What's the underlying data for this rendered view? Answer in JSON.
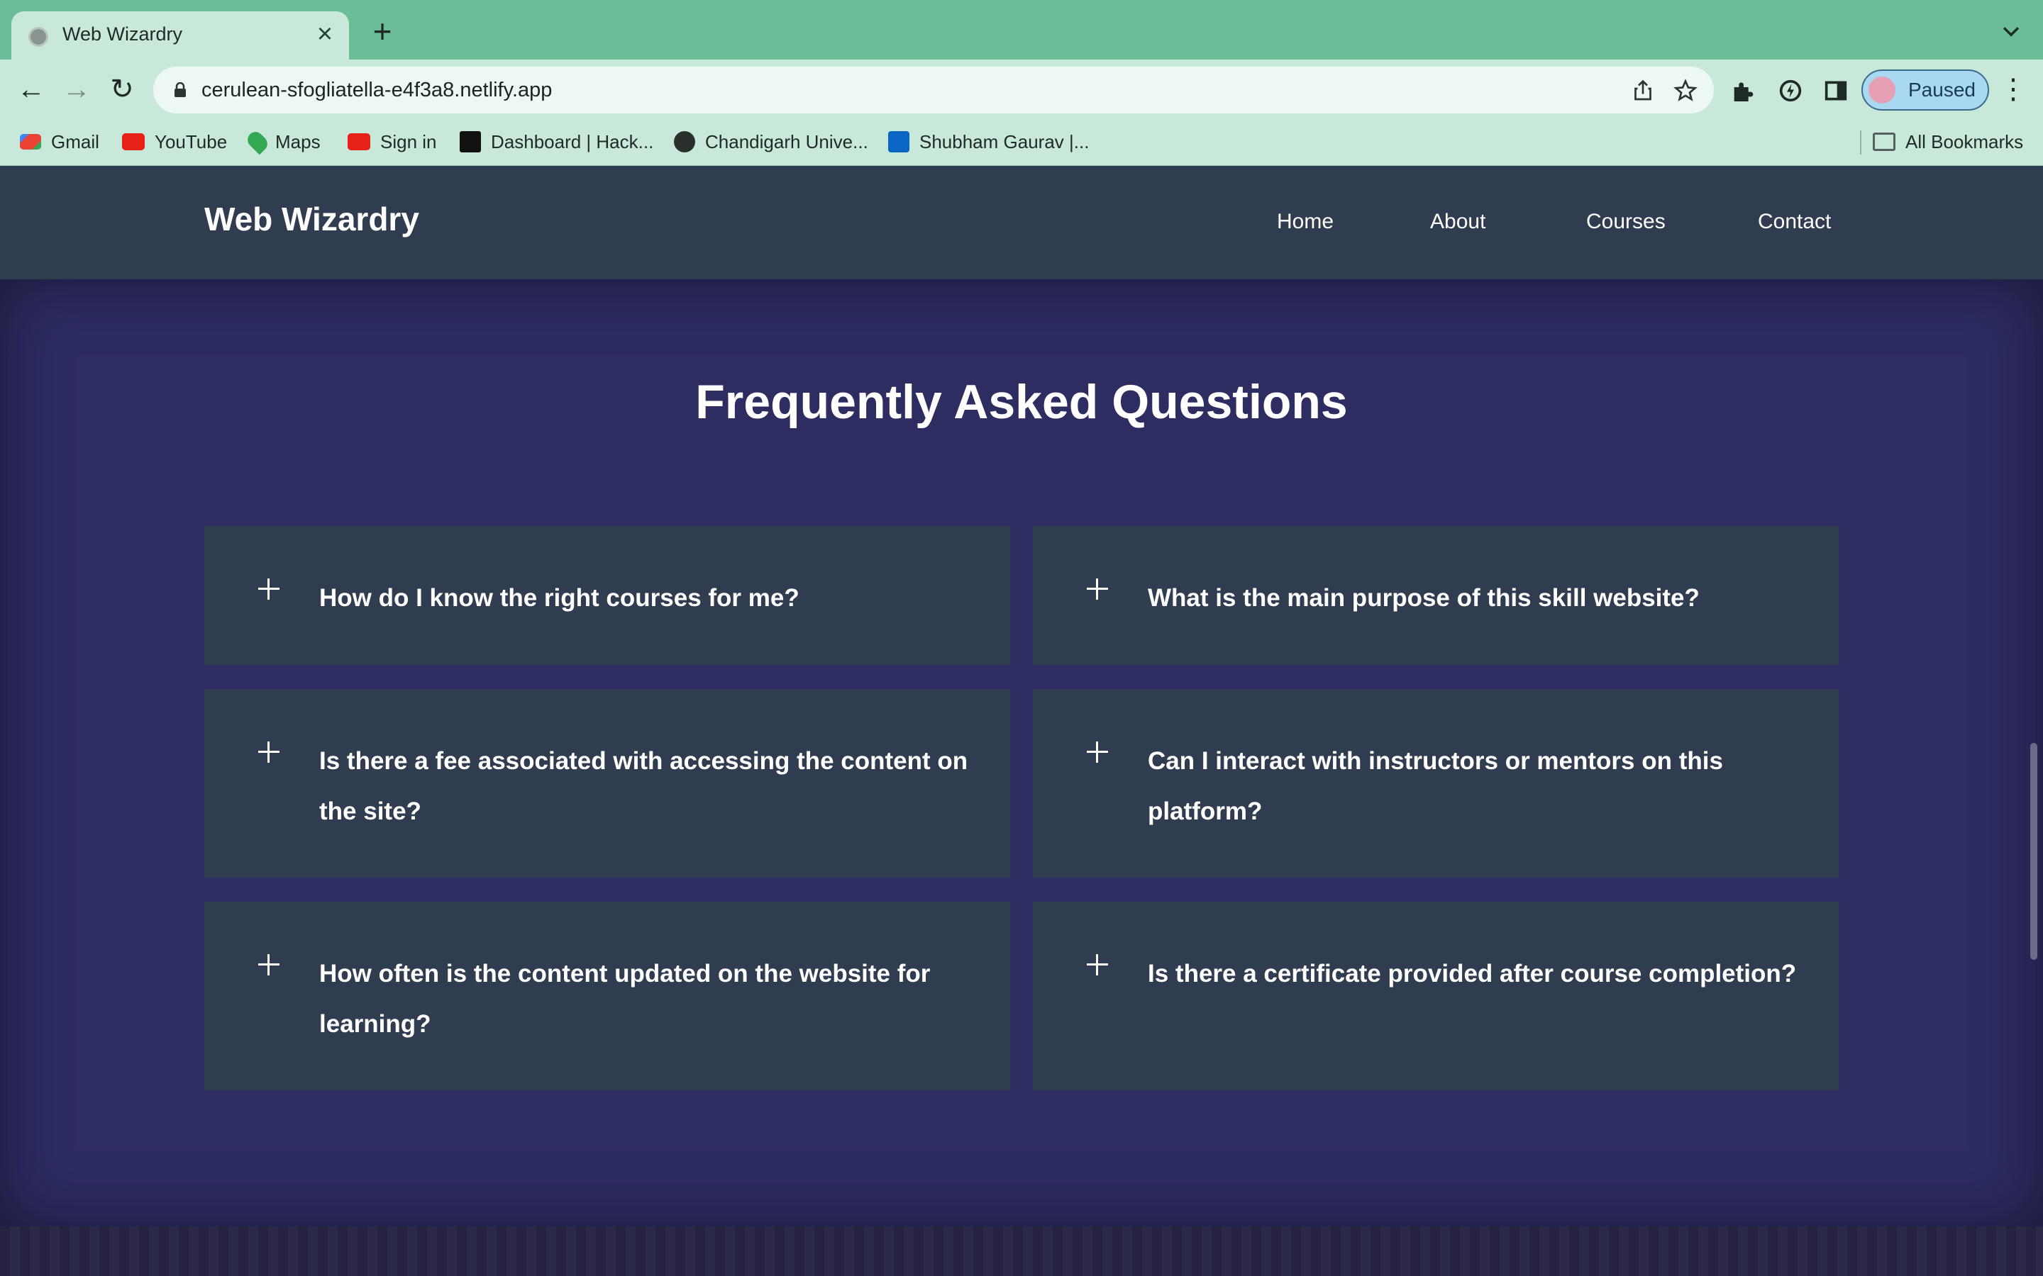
{
  "browser": {
    "tab_title": "Web Wizardry",
    "url": "cerulean-sfogliatella-e4f3a8.netlify.app",
    "profile_label": "Paused",
    "bookmarks": [
      {
        "label": "Gmail",
        "icon": "gmail-icon"
      },
      {
        "label": "YouTube",
        "icon": "youtube-icon"
      },
      {
        "label": "Maps",
        "icon": "maps-icon"
      },
      {
        "label": "Sign in",
        "icon": "youtube-icon"
      },
      {
        "label": "Dashboard | Hack...",
        "icon": "hackerrank-icon"
      },
      {
        "label": "Chandigarh Unive...",
        "icon": "globe-icon"
      },
      {
        "label": "Shubham Gaurav |...",
        "icon": "linkedin-icon"
      }
    ],
    "all_bookmarks_label": "All Bookmarks"
  },
  "site": {
    "brand": "Web Wizardry",
    "nav": [
      "Home",
      "About",
      "Courses",
      "Contact"
    ]
  },
  "faq": {
    "title": "Frequently Asked Questions",
    "questions": [
      "How do I know the right courses for me?",
      "What is the main purpose of this skill website?",
      "Is there a fee associated with accessing the content on the site?",
      "Can I interact with instructors or mentors on this platform?",
      "How often is the content updated on the website for learning?",
      "Is there a certificate provided after course completion?"
    ]
  },
  "colors": {
    "tabstrip": "#6bbd98",
    "toolbar": "#c8e9d9",
    "header": "#303c4f",
    "section_bg": "#2e2d62",
    "card": "#303c4f"
  }
}
